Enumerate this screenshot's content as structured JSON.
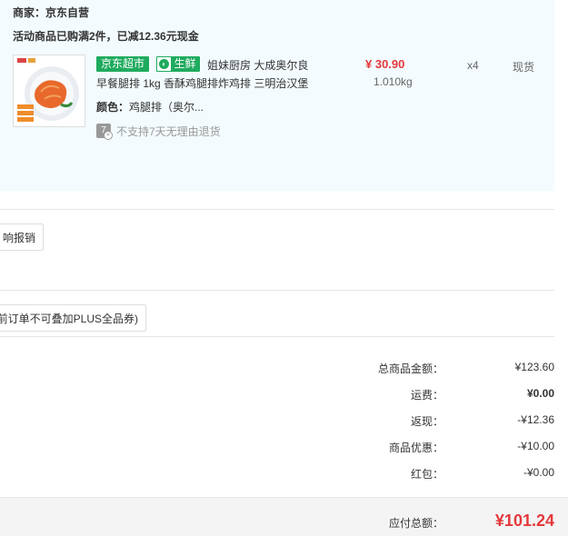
{
  "order": {
    "merchant": "商家：京东自营",
    "promo": "活动商品已购满2件，已减12.36元现金",
    "item": {
      "tag_jd": "京东超市",
      "tag_fresh": "生鲜",
      "title_line1": "姐妹厨房 大成奥尔良",
      "title_line2": "早餐腿排 1kg 香酥鸡腿排炸鸡排 三明治汉堡",
      "price": "¥ 30.90",
      "weight": "1.010kg",
      "quantity": "x4",
      "stock": "现货",
      "color_label": "颜色：",
      "color_value": "鸡腿排（奥尔...",
      "no_return": "不支持7天无理由退货",
      "no_return_icon_text": "7"
    }
  },
  "buttons": {
    "invoice": "响报销",
    "coupon": "前订单不可叠加PLUS全品券)"
  },
  "summary": [
    {
      "label": "总商品金额：",
      "value": "¥123.60",
      "bold": false
    },
    {
      "label": "运费：",
      "value": "¥0.00",
      "bold": true
    },
    {
      "label": "返现：",
      "value": "-¥12.36",
      "bold": false
    },
    {
      "label": "商品优惠：",
      "value": "-¥10.00",
      "bold": false
    },
    {
      "label": "红包：",
      "value": "-¥0.00",
      "bold": false
    }
  ],
  "total": {
    "label": "应付总额：",
    "value": "¥101.24"
  },
  "colors": {
    "accent_red": "#e4393c",
    "jd_green": "#1fab5e",
    "block_bg": "#f3fbfe"
  }
}
